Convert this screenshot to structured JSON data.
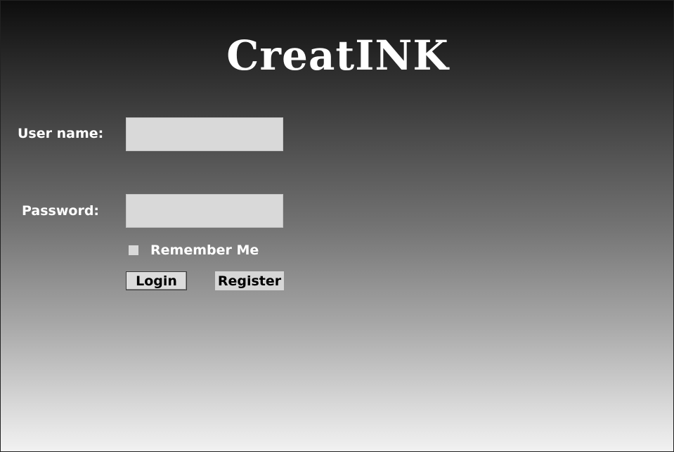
{
  "app": {
    "logo_text": "CreatINK"
  },
  "form": {
    "username_label": "User name:",
    "username_value": "",
    "password_label": "Password:",
    "password_value": "",
    "remember_label": "Remember Me",
    "remember_checked": false,
    "login_label": "Login",
    "register_label": "Register"
  }
}
